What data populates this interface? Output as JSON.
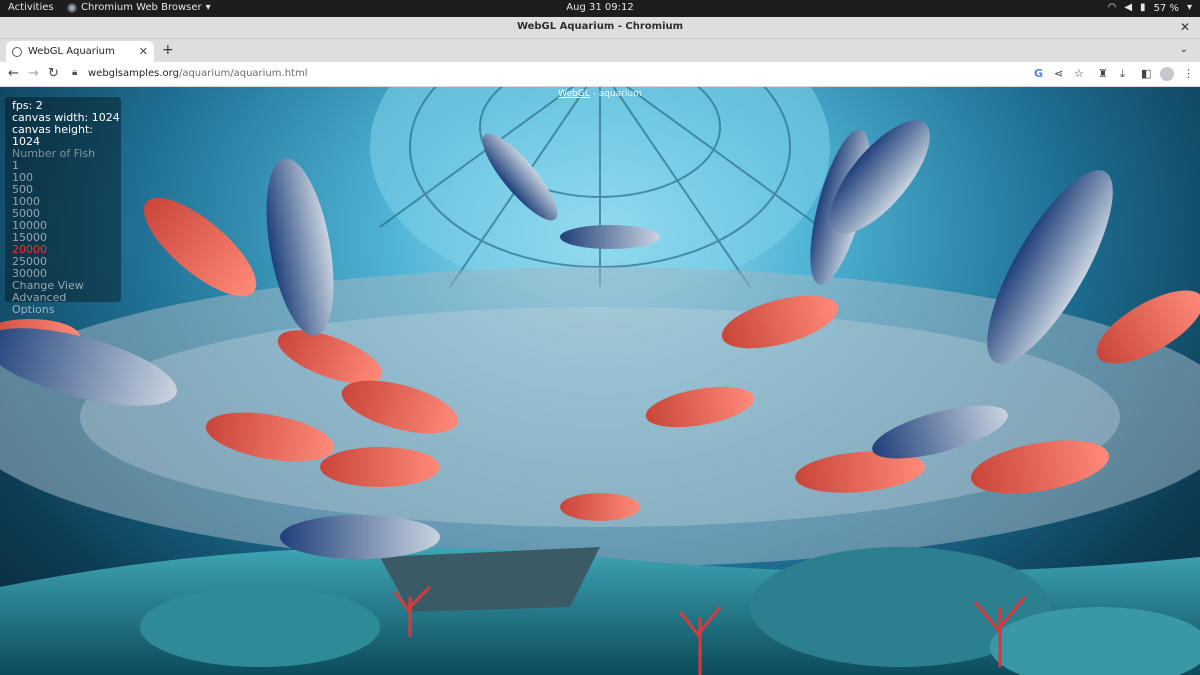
{
  "topbar": {
    "activities": "Activities",
    "app_name": "Chromium Web Browser",
    "datetime": "Aug 31  09:12",
    "battery": "57 %"
  },
  "window": {
    "title": "WebGL Aquarium - Chromium"
  },
  "tabs": [
    {
      "label": "WebGL Aquarium"
    }
  ],
  "toolbar": {
    "url_host": "webglsamples.org",
    "url_path": "/aquarium/aquarium.html"
  },
  "page": {
    "caption_link": "WebGL",
    "caption_rest": " - aquarium",
    "stats": {
      "fps": "fps: 2",
      "canvas_width": "canvas width: 1024",
      "canvas_height": "canvas height: 1024"
    },
    "fish_label": "Number of Fish",
    "fish_options": [
      "1",
      "100",
      "500",
      "1000",
      "5000",
      "10000",
      "15000",
      "20000",
      "25000",
      "30000"
    ],
    "selected_fish": "20000",
    "menu": [
      "Change View",
      "Advanced",
      "Options"
    ]
  }
}
